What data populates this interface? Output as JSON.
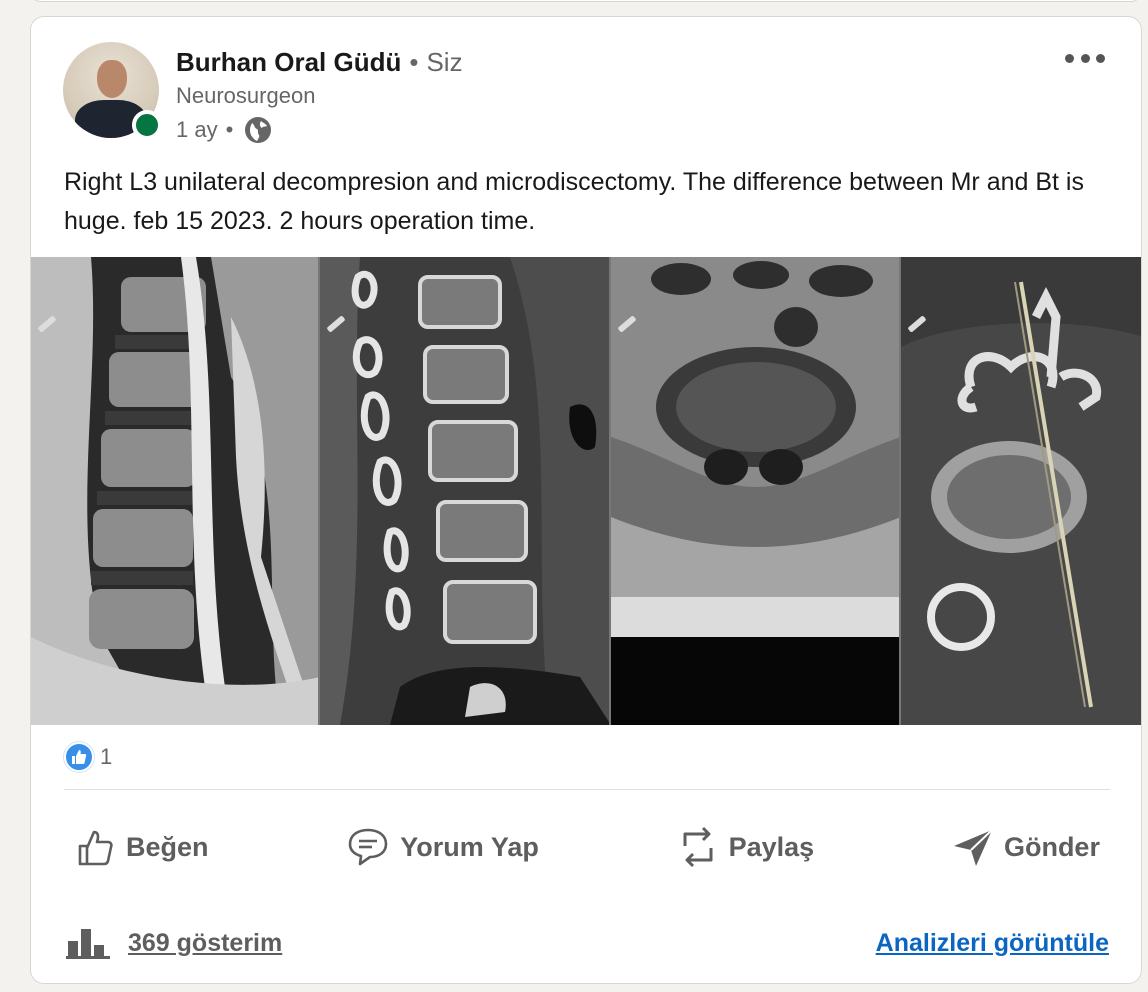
{
  "post": {
    "author": {
      "name": "Burhan Oral Güdü",
      "separator": "•",
      "you_label": "Siz",
      "headline": "Neurosurgeon",
      "time": "1 ay",
      "meta_separator": "•",
      "visibility_icon": "globe-icon",
      "online_status_color": "#057642"
    },
    "more_icon": "ellipsis-icon",
    "text": "Right L3 unilateral decompresion and microdiscectomy. The difference between Mr and Bt is huge. feb 15 2023. 2 hours operation time.",
    "media": {
      "panels": [
        "sagittal-mri",
        "sagittal-ct",
        "axial-mri",
        "axial-ct"
      ]
    },
    "reactions": {
      "icon": "like-reaction-icon",
      "count": "1"
    },
    "actions": {
      "like": "Beğen",
      "comment": "Yorum Yap",
      "repost": "Paylaş",
      "send": "Gönder"
    },
    "impressions": {
      "icon": "bar-chart-icon",
      "label": "369 gösterim"
    },
    "analytics_link": "Analizleri görüntüle"
  },
  "colors": {
    "link": "#0a66c2",
    "like_badge": "#378fe9",
    "muted_text": "#666666"
  }
}
